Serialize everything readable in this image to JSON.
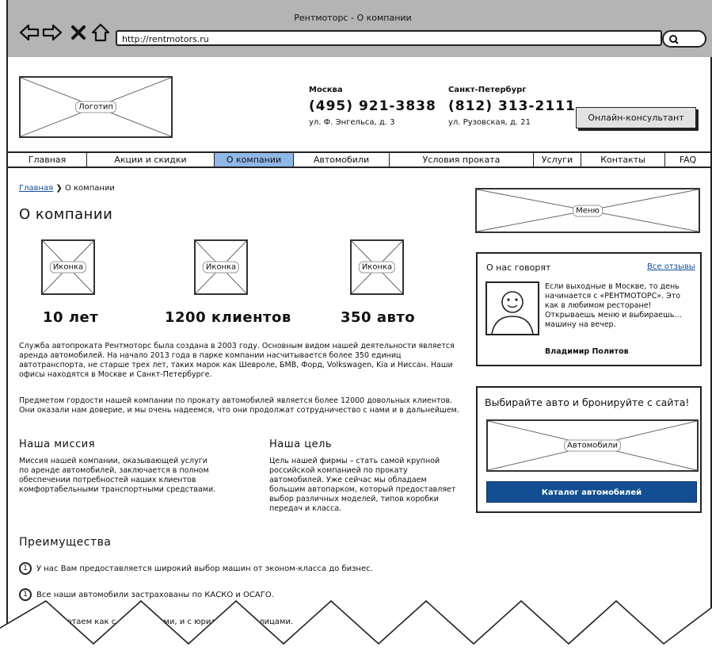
{
  "window": {
    "title": "Рентмоторс - О компании",
    "url": "http://rentmotors.ru"
  },
  "header": {
    "logo_label": "Логотип",
    "offices": [
      {
        "city": "Москва",
        "phone": "(495) 921-3838",
        "address": "ул. Ф. Энгельса, д. 3"
      },
      {
        "city": "Санкт-Петербург",
        "phone": "(812) 313-2111",
        "address": "ул. Рузовская, д. 21"
      }
    ],
    "consultant_button": "Онлайн-консультант"
  },
  "menu": {
    "items": [
      "Главная",
      "Акции и скидки",
      "О компании",
      "Автомобили",
      "Условия проката",
      "Услуги",
      "Контакты",
      "FAQ"
    ],
    "active": "О компании"
  },
  "breadcrumb": {
    "home": "Главная",
    "separator": "❯",
    "current": "О компании"
  },
  "page_title": "О компании",
  "stats": [
    {
      "icon_label": "Иконка",
      "value": "10 лет"
    },
    {
      "icon_label": "Иконка",
      "value": "1200 клиентов"
    },
    {
      "icon_label": "Иконка",
      "value": "350 авто"
    }
  ],
  "about": {
    "paragraph1": "Служба автопроката Рентмоторс была создана в 2003 году. Основным видом нашей деятельности является аренда автомобилей. На начало 2013 года в парке компании насчитывается более 350 единиц автотранспорта, не старше трех лет, таких марок как Шевроле, БМВ, Форд, Volkswagen, Kia и Ниссан. Наши офисы находятся в Москве и Санкт-Петербурге.",
    "paragraph2": "Предметом гордости нашей компании по прокату автомобилей является более 12000 довольных клиентов. Они оказали нам доверие, и мы очень надеемся, что они продолжат сотрудничество с нами и в дальнейшем."
  },
  "mission": {
    "title": "Наша миссия",
    "text": "Миссия нашей компании, оказывающей услуги по аренде автомобилей, заключается в полном обеспечении потребностей наших клиентов комфортабельными транспортными средствами."
  },
  "goal": {
    "title": "Наша цель",
    "text": "Цель нашей фирмы – стать самой крупной российской компанией по прокату автомобилей. Уже сейчас мы обладаем большим автопарком, который предоставляет выбор различных моделей, типов коробки передач и класса."
  },
  "advantages": {
    "title": "Преимущества",
    "items": [
      {
        "number": "1",
        "text": "У нас Вам предоставляется широкий выбор машин от эконом-класса до бизнес."
      },
      {
        "number": "1",
        "text": "Все наши автомобили застрахованы по КАСКО и ОСАГО."
      },
      {
        "number": "1",
        "text": "Мы работаем как с физическими, и с юридическими лицами."
      }
    ]
  },
  "sidebar": {
    "menu_label": "Меню",
    "reviews": {
      "title": "О нас говорят",
      "all_link": "Все отзывы",
      "text": "Если выходные в Москве, то день начинается с «РЕНТМОТОРС». Это как в любимом ресторане! Открываешь меню и выбираешь… машину на вечер.",
      "author": "Владимир Политов"
    },
    "booking": {
      "title": "Выбирайте авто и бронируйте с сайта!",
      "image_label": "Автомобили",
      "button": "Каталог автомобилей"
    }
  },
  "colors": {
    "active_menu": "#8fb7e8",
    "catalog_button": "#124e91",
    "link": "#124fa8",
    "chrome": "#b4b4b4"
  }
}
